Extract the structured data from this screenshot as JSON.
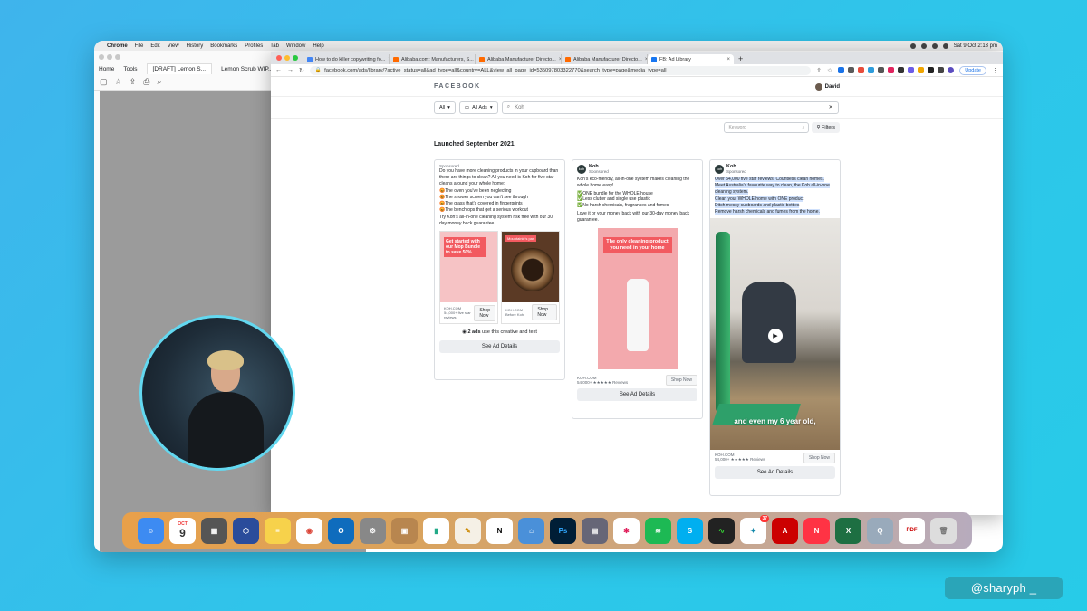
{
  "menubar": {
    "apple": "",
    "app": "Chrome",
    "items": [
      "File",
      "Edit",
      "View",
      "History",
      "Bookmarks",
      "Profiles",
      "Tab",
      "Window",
      "Help"
    ],
    "clock": "Sat 9 Oct  2:13 pm"
  },
  "bgapp": {
    "tabs": [
      "Home",
      "Tools",
      "[DRAFT] Lemon S...",
      "Lemon Scrub WIP..."
    ]
  },
  "chrome": {
    "tabs": [
      {
        "label": "How to do killer copywriting fo...",
        "color": "#4285f4"
      },
      {
        "label": "Alibaba.com: Manufacturers, S...",
        "color": "#ff6a00"
      },
      {
        "label": "Alibaba Manufacturer Directo...",
        "color": "#ff6a00"
      },
      {
        "label": "Alibaba Manufacturer Directo...",
        "color": "#ff6a00"
      },
      {
        "label": "FB: Ad Library",
        "color": "#1877f2"
      }
    ],
    "url": "facebook.com/ads/library/?active_status=all&ad_type=all&country=ALL&view_all_page_id=535097803322770&search_type=page&media_type=all",
    "update_label": "Update"
  },
  "fb": {
    "logo": "FACEBOOK",
    "user": "David",
    "filter_all": "All",
    "filter_ads": "All Ads",
    "search_value": "Koh",
    "keyword_placeholder": "Keyword",
    "filters_label": "Filters",
    "section_title": "Launched September 2021"
  },
  "cards": [
    {
      "sponsored": "Sponsored",
      "body": "Do you have more cleaning products in your cupboard than there are things to clean? All you need is Koh for five star cleans around your whole home:",
      "bullets": [
        "😡The oven you've been neglecting",
        "😡The shower screen you can't see through",
        "😡The glass that's covered in fingerprints",
        "😡The benchtops that get a serious workout"
      ],
      "cta_text": "Try Koh's all-in-one cleaning system risk free with our 30 day money back guarantee.",
      "slide1_text": "Get started with our Mop Bundle to save 50%",
      "slide1_meta": "KOH.COM\n54,000+ five star reviews",
      "slide2_tag": "Mountainie's pan",
      "slide2_meta": "KOH.COM\nBefore Koh",
      "shop": "Shop Now",
      "ads_count": "2 ads",
      "ads_text": "use this creative and text",
      "details": "See Ad Details"
    },
    {
      "name": "Koh",
      "sponsored": "Sponsored",
      "body": "Koh's eco-friendly, all-in-one system makes cleaning the whole home easy!",
      "bullets": [
        "✅ONE bundle for the WHOLE house",
        "✅Less clutter and single use plastic",
        "✅No harsh chemicals, fragrances and fumes"
      ],
      "cta_text": "Love it or your money back with our 30-day money back guarantee.",
      "image_text": "The only cleaning product you need in your home",
      "domain": "KOH.COM",
      "reviews": "54,000+ ★★★★★ Reviews",
      "shop": "Shop Now",
      "details": "See Ad Details"
    },
    {
      "name": "Koh",
      "sponsored": "Sponsored",
      "body": "Over 54,000 five star reviews. Countless clean homes. Meet Australia's favourite way to clean, the Koh all-in-one cleaning system.",
      "bullets": [
        "Clean your WHOLE home with ONE product",
        "Ditch messy cupboards and plastic bottles",
        "Remove harsh chemicals and fumes from the home."
      ],
      "video_caption": "and even my 6 year old,",
      "domain": "KOH.COM",
      "reviews": "54,000+ ★★★★★ Reviews",
      "shop": "Shop Now",
      "details": "See Ad Details"
    }
  ],
  "dock": {
    "calendar_month": "OCT",
    "calendar_day": "9",
    "badge": "37"
  },
  "overlay": {
    "handle": "@sharyph _"
  }
}
